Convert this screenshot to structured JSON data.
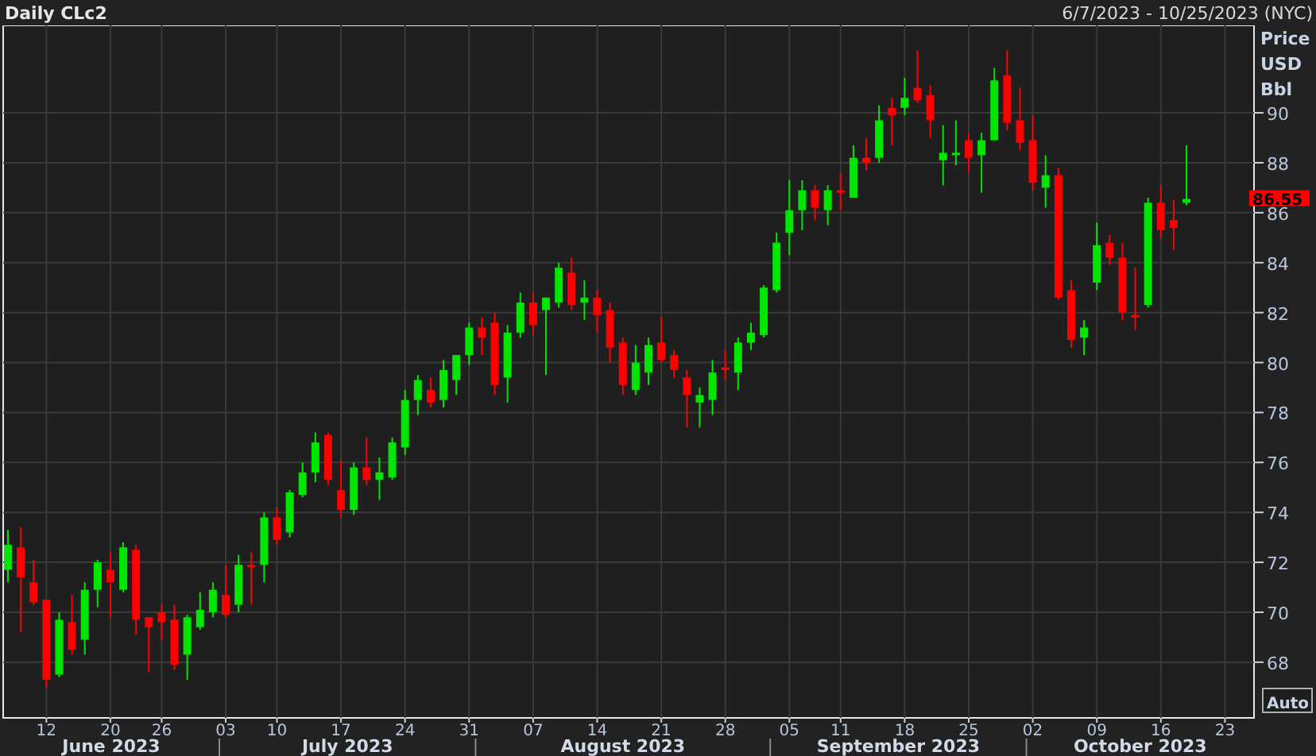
{
  "header": {
    "title": "Daily CLc2",
    "date_range": "6/7/2023 - 10/25/2023 (NYC)"
  },
  "axis_units": [
    "Price",
    "USD",
    "Bbl"
  ],
  "chart": {
    "chart_data": {
      "type": "candlestick",
      "grid": true,
      "ylim": [
        65.77,
        93.5
      ],
      "yticks": [
        68,
        70,
        72,
        74,
        76,
        78,
        80,
        82,
        84,
        86,
        88,
        90
      ],
      "categories": [
        null,
        null,
        null,
        "12",
        null,
        null,
        null,
        null,
        "20",
        null,
        null,
        null,
        "26",
        null,
        null,
        null,
        null,
        "03",
        null,
        null,
        null,
        "10",
        null,
        null,
        null,
        null,
        "17",
        null,
        null,
        null,
        null,
        "24",
        null,
        null,
        null,
        null,
        "31",
        null,
        null,
        null,
        null,
        "07",
        null,
        null,
        null,
        null,
        "14",
        null,
        null,
        null,
        null,
        "21",
        null,
        null,
        null,
        null,
        "28",
        null,
        null,
        null,
        null,
        "05",
        null,
        null,
        null,
        "11",
        null,
        null,
        null,
        null,
        "18",
        null,
        null,
        null,
        null,
        "25",
        null,
        null,
        null,
        null,
        "02",
        null,
        null,
        null,
        null,
        "09",
        null,
        null,
        null,
        null,
        "16",
        null,
        null,
        null,
        null,
        "23"
      ],
      "ohlc": [
        [
          71.7,
          73.3,
          71.2,
          72.7
        ],
        [
          72.6,
          73.4,
          69.2,
          71.4
        ],
        [
          71.2,
          72.1,
          70.3,
          70.4
        ],
        [
          70.5,
          70.5,
          67.0,
          67.3
        ],
        [
          67.5,
          70.0,
          67.4,
          69.7
        ],
        [
          69.6,
          70.7,
          68.3,
          68.5
        ],
        [
          68.9,
          71.2,
          68.3,
          70.9
        ],
        [
          70.9,
          72.1,
          70.2,
          72.0
        ],
        [
          71.7,
          72.4,
          69.8,
          71.2
        ],
        [
          70.9,
          72.8,
          70.8,
          72.6
        ],
        [
          72.5,
          72.7,
          69.1,
          69.7
        ],
        [
          69.8,
          69.8,
          67.6,
          69.4
        ],
        [
          70.0,
          70.3,
          68.9,
          69.6
        ],
        [
          69.7,
          70.3,
          67.7,
          67.9
        ],
        [
          68.3,
          69.9,
          67.3,
          69.8
        ],
        [
          69.4,
          70.8,
          69.3,
          70.1
        ],
        [
          70.0,
          71.2,
          69.8,
          70.9
        ],
        [
          70.7,
          71.9,
          69.8,
          69.9
        ],
        [
          70.3,
          72.3,
          70.0,
          71.9
        ],
        [
          71.9,
          72.4,
          70.3,
          71.8
        ],
        [
          71.9,
          74.0,
          71.2,
          73.8
        ],
        [
          73.8,
          74.2,
          72.7,
          72.9
        ],
        [
          73.2,
          74.9,
          73.0,
          74.8
        ],
        [
          74.7,
          76.0,
          74.6,
          75.6
        ],
        [
          75.6,
          77.2,
          75.2,
          76.8
        ],
        [
          77.1,
          77.2,
          75.1,
          75.3
        ],
        [
          74.9,
          76.1,
          73.8,
          74.1
        ],
        [
          74.1,
          76.0,
          73.9,
          75.8
        ],
        [
          75.8,
          77.0,
          75.1,
          75.3
        ],
        [
          75.3,
          76.2,
          74.5,
          75.6
        ],
        [
          75.4,
          77.0,
          75.3,
          76.8
        ],
        [
          76.6,
          78.9,
          76.3,
          78.5
        ],
        [
          78.5,
          79.5,
          77.9,
          79.3
        ],
        [
          78.9,
          79.4,
          78.2,
          78.4
        ],
        [
          78.5,
          80.1,
          78.2,
          79.7
        ],
        [
          79.3,
          80.3,
          78.7,
          80.3
        ],
        [
          80.3,
          81.6,
          79.9,
          81.4
        ],
        [
          81.4,
          81.8,
          80.3,
          81.0
        ],
        [
          81.6,
          82.0,
          78.7,
          79.1
        ],
        [
          79.4,
          81.5,
          78.4,
          81.2
        ],
        [
          81.2,
          82.8,
          81.0,
          82.4
        ],
        [
          82.4,
          82.8,
          81.1,
          81.5
        ],
        [
          82.1,
          82.6,
          79.5,
          82.6
        ],
        [
          82.4,
          84.0,
          82.2,
          83.8
        ],
        [
          83.6,
          84.2,
          82.1,
          82.3
        ],
        [
          82.4,
          83.3,
          81.7,
          82.6
        ],
        [
          82.6,
          82.9,
          81.2,
          81.9
        ],
        [
          82.1,
          82.4,
          80.0,
          80.6
        ],
        [
          80.8,
          81.0,
          78.7,
          79.1
        ],
        [
          78.9,
          80.7,
          78.7,
          80.0
        ],
        [
          79.6,
          81.0,
          79.1,
          80.7
        ],
        [
          80.8,
          81.8,
          80.0,
          80.1
        ],
        [
          80.3,
          80.5,
          79.4,
          79.7
        ],
        [
          79.4,
          79.7,
          77.4,
          78.7
        ],
        [
          78.4,
          79.0,
          77.4,
          78.7
        ],
        [
          78.5,
          80.1,
          77.9,
          79.6
        ],
        [
          79.8,
          80.5,
          79.3,
          79.7
        ],
        [
          79.6,
          81.0,
          78.9,
          80.8
        ],
        [
          80.8,
          81.6,
          80.5,
          81.2
        ],
        [
          81.1,
          83.1,
          81.0,
          83.0
        ],
        [
          82.9,
          85.2,
          82.8,
          84.8
        ],
        [
          85.2,
          87.3,
          84.3,
          86.1
        ],
        [
          86.1,
          87.3,
          85.3,
          86.9
        ],
        [
          86.9,
          87.1,
          85.7,
          86.2
        ],
        [
          86.1,
          87.1,
          85.5,
          86.9
        ],
        [
          86.9,
          87.6,
          86.1,
          86.8
        ],
        [
          86.6,
          88.7,
          86.6,
          88.2
        ],
        [
          88.2,
          89.0,
          87.7,
          88.0
        ],
        [
          88.2,
          90.3,
          88.0,
          89.7
        ],
        [
          90.2,
          90.6,
          88.7,
          89.9
        ],
        [
          90.2,
          91.4,
          89.9,
          90.6
        ],
        [
          91.0,
          92.5,
          90.4,
          90.5
        ],
        [
          90.7,
          91.1,
          89.0,
          89.7
        ],
        [
          88.1,
          89.5,
          87.1,
          88.4
        ],
        [
          88.3,
          89.7,
          87.9,
          88.4
        ],
        [
          88.9,
          89.2,
          87.6,
          88.2
        ],
        [
          88.3,
          89.2,
          86.8,
          88.9
        ],
        [
          88.9,
          91.8,
          88.9,
          91.3
        ],
        [
          91.5,
          92.5,
          89.3,
          89.6
        ],
        [
          89.7,
          91.0,
          88.5,
          88.8
        ],
        [
          88.9,
          89.9,
          86.9,
          87.2
        ],
        [
          87.0,
          88.3,
          86.2,
          87.5
        ],
        [
          87.5,
          87.8,
          82.5,
          82.6
        ],
        [
          82.9,
          83.3,
          80.6,
          80.9
        ],
        [
          81.0,
          81.7,
          80.3,
          81.4
        ],
        [
          83.2,
          85.6,
          82.9,
          84.7
        ],
        [
          84.8,
          85.1,
          83.9,
          84.2
        ],
        [
          84.2,
          84.8,
          81.7,
          82.0
        ],
        [
          81.9,
          83.8,
          81.3,
          81.8
        ],
        [
          82.3,
          86.6,
          82.2,
          86.4
        ],
        [
          86.4,
          87.1,
          85.0,
          85.3
        ],
        [
          85.7,
          86.5,
          84.5,
          85.4
        ],
        [
          86.4,
          88.7,
          86.3,
          86.55
        ],
        null,
        null,
        null
      ]
    }
  },
  "last_price": {
    "label": "86.55"
  },
  "month_labels": [
    {
      "label": "June 2023"
    },
    {
      "label": "July 2023"
    },
    {
      "label": "August 2023"
    },
    {
      "label": "September 2023"
    },
    {
      "label": "October 2023"
    }
  ],
  "scale_button": {
    "label": "Auto"
  }
}
